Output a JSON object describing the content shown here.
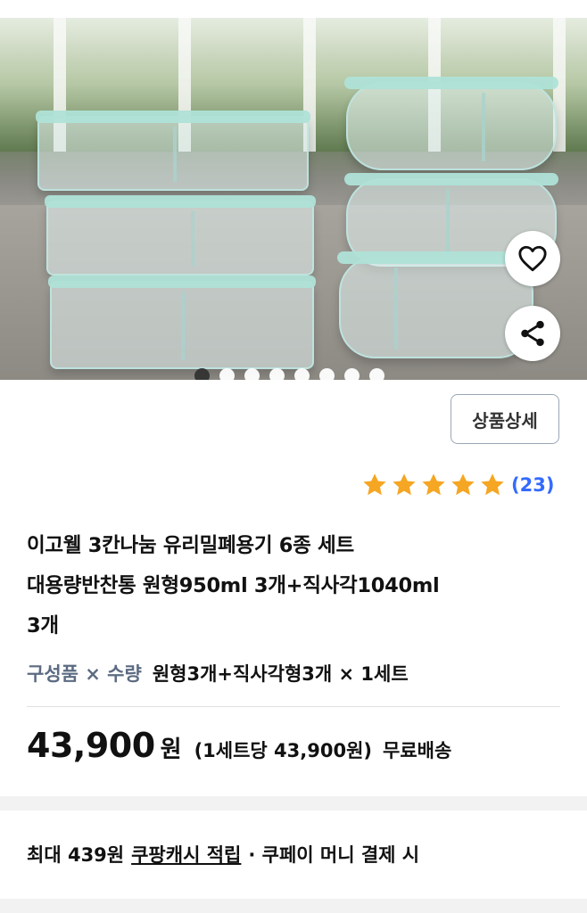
{
  "product": {
    "title_line1": "이고웰 3칸나눔 유리밀폐용기 6종 세트",
    "title_line2": "대용량반찬통 원형950ml 3개+직사각1040ml",
    "title_line3": "3개",
    "detail_button": "상품상세",
    "rating": {
      "stars": 5,
      "review_count": "(23)",
      "star_color": "#f5a623"
    },
    "option": {
      "label": "구성품 × 수량",
      "value": "원형3개+직사각형3개 × 1세트"
    },
    "price": {
      "amount": "43,900",
      "currency": "원",
      "unit_price": "(1세트당 43,900원)",
      "delivery": "무료배송"
    },
    "cash": {
      "prefix": "최대 439원",
      "link": "쿠팡캐시 적립",
      "suffix": "· 쿠페이 머니 결제 시"
    }
  },
  "gallery": {
    "image_count": 8,
    "active_index": 0,
    "icons": {
      "favorite": "heart-outline-icon",
      "share": "share-icon"
    }
  },
  "colors": {
    "accent_blue": "#346aff",
    "star_yellow": "#f5a623",
    "option_label": "#5c6b82"
  }
}
